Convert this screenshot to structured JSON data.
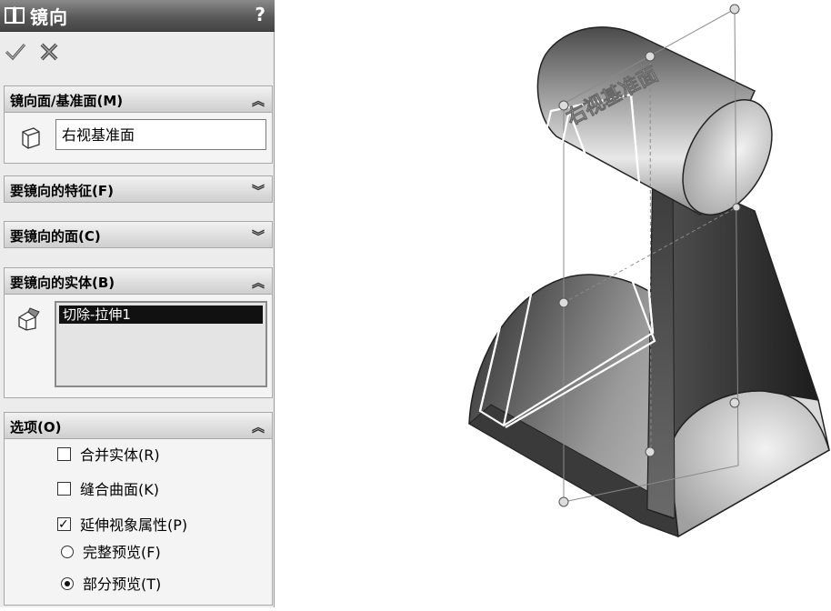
{
  "panel": {
    "title": "镜向",
    "help": "?"
  },
  "sections": {
    "mirror_face": {
      "label": "镜向面/基准面(M)",
      "value": "右视基准面"
    },
    "features": {
      "label": "要镜向的特征(F)"
    },
    "faces": {
      "label": "要镜向的面(C)"
    },
    "bodies": {
      "label": "要镜向的实体(B)",
      "items": [
        "切除-拉伸1"
      ]
    },
    "options": {
      "label": "选项(O)",
      "items": [
        {
          "label": "合并实体(R)",
          "type": "checkbox",
          "checked": false
        },
        {
          "label": "缝合曲面(K)",
          "type": "checkbox",
          "checked": false
        },
        {
          "label": "延伸视象属性(P)",
          "type": "checkbox",
          "checked": true
        },
        {
          "label": "完整预览(F)",
          "type": "radio",
          "checked": false
        },
        {
          "label": "部分预览(T)",
          "type": "radio",
          "checked": true
        }
      ]
    }
  },
  "icons": {
    "ok": "check-icon",
    "cancel": "cancel-x-icon",
    "collapse": "double-chevron-up-icon",
    "expand": "double-chevron-down-icon"
  },
  "viewport": {
    "plane_label": "右视基准面"
  }
}
